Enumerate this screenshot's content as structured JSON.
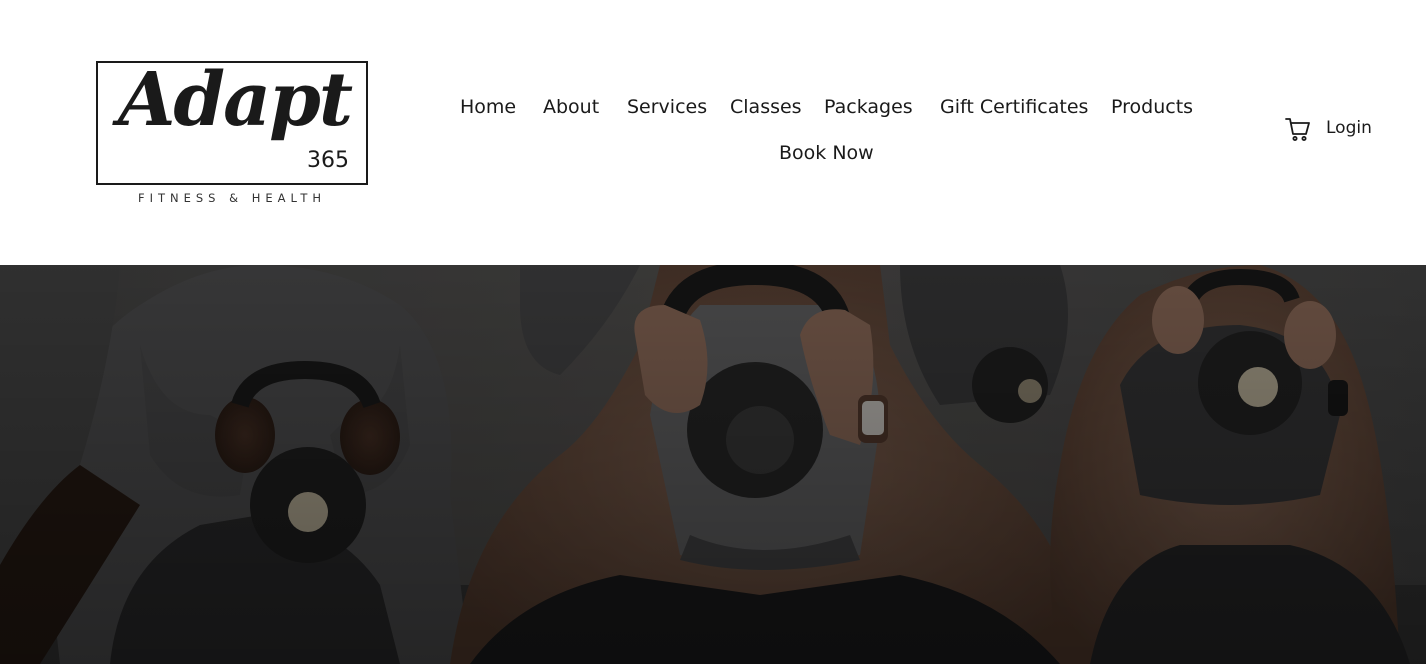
{
  "logo": {
    "script_text": "Adapt",
    "number": "365",
    "tagline": "FITNESS & HEALTH"
  },
  "nav": {
    "items": [
      {
        "label": "Home"
      },
      {
        "label": "About"
      },
      {
        "label": "Services"
      },
      {
        "label": "Classes"
      },
      {
        "label": "Packages"
      },
      {
        "label": "Gift Certificates"
      },
      {
        "label": "Products"
      },
      {
        "label": "Book Now"
      }
    ]
  },
  "header_actions": {
    "cart_icon": "shopping-cart-icon",
    "login_label": "Login"
  },
  "colors": {
    "text": "#1a1a1a",
    "background": "#ffffff",
    "hero_overlay": "#000000"
  }
}
